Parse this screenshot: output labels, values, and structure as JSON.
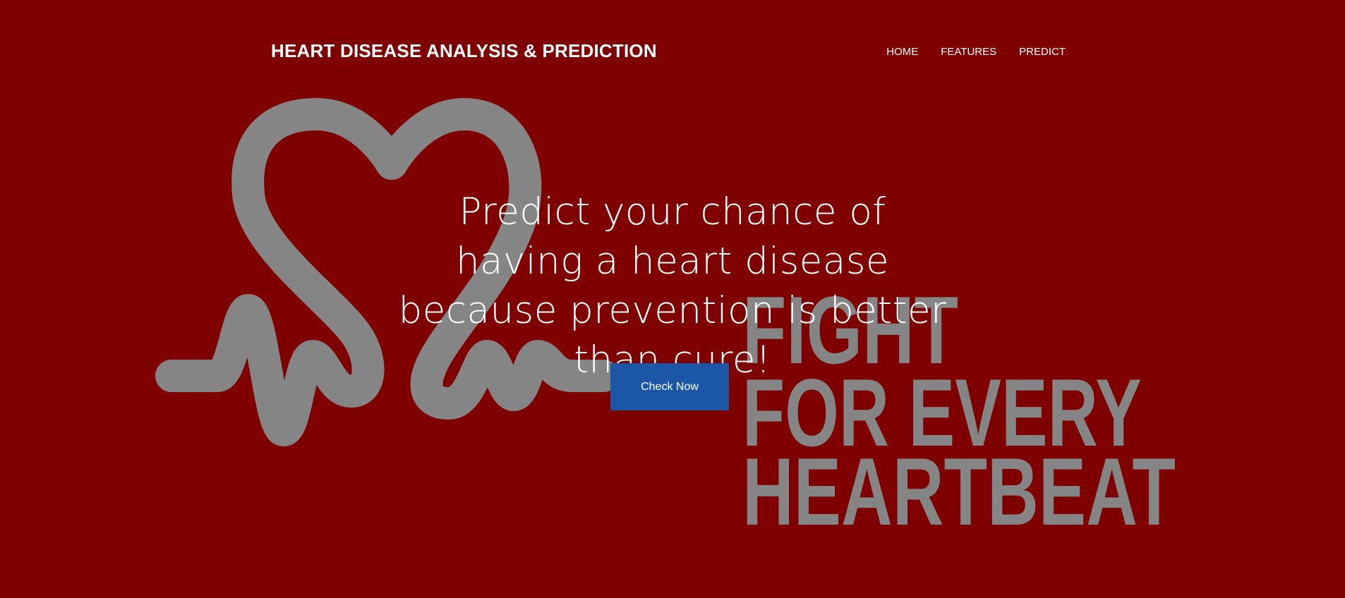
{
  "header": {
    "brand": "HEART DISEASE ANALYSIS & PREDICTION",
    "nav": [
      {
        "label": "HOME"
      },
      {
        "label": "FEATURES"
      },
      {
        "label": "PREDICT"
      }
    ]
  },
  "hero": {
    "heading": "Predict your chance of having a heart disease because prevention is better than cure!",
    "cta_label": "Check Now",
    "background_slogan": [
      "FIGHT",
      "FOR EVERY",
      "HEARTBEAT"
    ]
  },
  "colors": {
    "background": "#7f0000",
    "artwork": "#858585",
    "cta": "#1b57a6",
    "text": "#ffffff"
  }
}
